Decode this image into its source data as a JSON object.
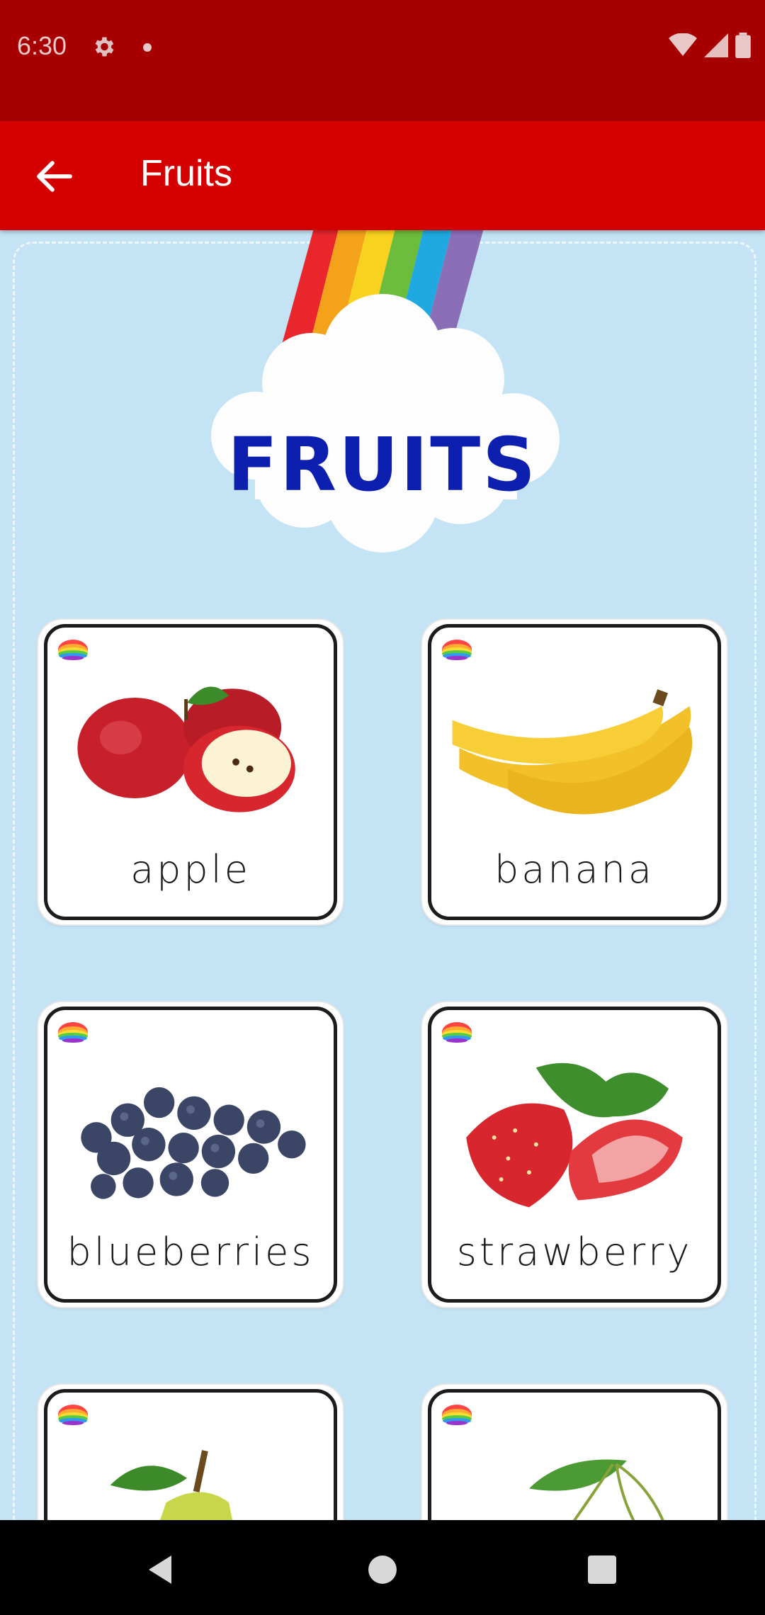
{
  "status_bar": {
    "time": "6:30",
    "icons": [
      "gear-icon",
      "dot-icon",
      "wifi-icon",
      "signal-icon",
      "battery-icon"
    ]
  },
  "app_bar": {
    "title": "Fruits",
    "back_icon": "arrow-left-icon",
    "color": "#d40000"
  },
  "banner": {
    "text": "FRUITS"
  },
  "cards": [
    {
      "label": "apple"
    },
    {
      "label": "banana"
    },
    {
      "label": "blueberries"
    },
    {
      "label": "strawberry"
    },
    {
      "label": ""
    },
    {
      "label": ""
    }
  ],
  "nav_bar": {
    "back": "back-triangle-icon",
    "home": "home-circle-icon",
    "recents": "recents-square-icon"
  },
  "colors": {
    "status_bar": "#a60000",
    "app_bar": "#d40000",
    "background": "#c4e4f5",
    "banner_text": "#0c1fae"
  }
}
